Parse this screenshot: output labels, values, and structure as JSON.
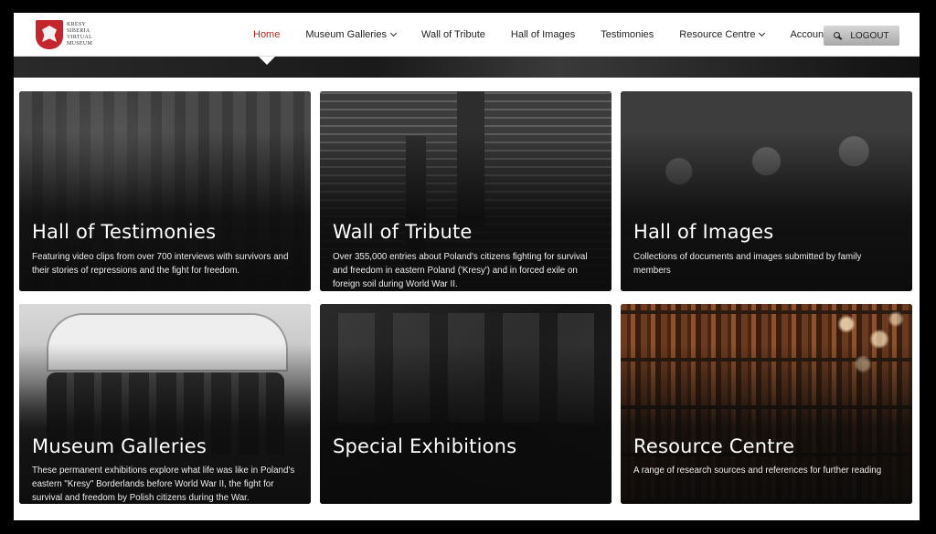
{
  "logo": {
    "lines": [
      "KRESY",
      "SIBERIA",
      "VIRTUAL",
      "MUSEUM"
    ]
  },
  "nav": {
    "items": [
      {
        "label": "Home",
        "active": true,
        "dropdown": false
      },
      {
        "label": "Museum Galleries",
        "active": false,
        "dropdown": true
      },
      {
        "label": "Wall of Tribute",
        "active": false,
        "dropdown": false
      },
      {
        "label": "Hall of Images",
        "active": false,
        "dropdown": false
      },
      {
        "label": "Testimonies",
        "active": false,
        "dropdown": false
      },
      {
        "label": "Resource Centre",
        "active": false,
        "dropdown": true
      },
      {
        "label": "Account",
        "active": false,
        "dropdown": false
      }
    ],
    "logout_label": "LOGOUT"
  },
  "cards": [
    {
      "title": "Hall of Testimonies",
      "description": "Featuring video clips from over 700 interviews with survivors and their stories of repressions and the fight for freedom."
    },
    {
      "title": "Wall of Tribute",
      "description": "Over 355,000 entries about Poland's citizens fighting for survival and freedom in eastern Poland ('Kresy') and in forced exile on foreign soil during World War II."
    },
    {
      "title": "Hall of Images",
      "description": "Collections of documents and images submitted by family members"
    },
    {
      "title": "Museum Galleries",
      "description": "These permanent exhibitions explore what life was like in Poland's eastern \"Kresy\" Borderlands before World War II, the fight for survival and freedom by Polish citizens during the War."
    },
    {
      "title": "Special Exhibitions",
      "description": ""
    },
    {
      "title": "Resource Centre",
      "description": "A range of research sources and references for further reading"
    }
  ],
  "colors": {
    "active_nav": "#b3261e",
    "header_bg": "#ffffff",
    "card_text": "#ffffff"
  }
}
